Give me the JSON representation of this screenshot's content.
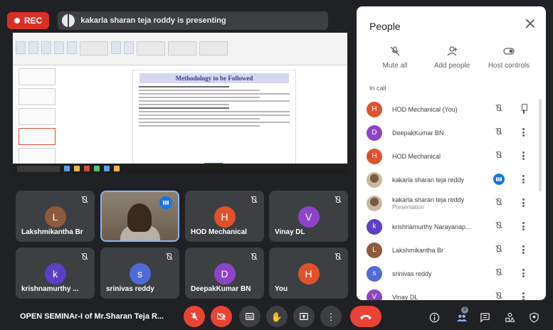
{
  "recording": {
    "label": "REC"
  },
  "presenting": {
    "text": "kakarla sharan teja roddy is presenting"
  },
  "slide": {
    "title": "Methodology to be Followed"
  },
  "tiles": [
    {
      "name": "Lakshmikantha Br",
      "initial": "L",
      "color": "#8d5a3b"
    },
    {
      "name": "",
      "initial": "",
      "color": ""
    },
    {
      "name": "HOD Mechanical",
      "initial": "H",
      "color": "#e0522b"
    },
    {
      "name": "Vinay DL",
      "initial": "V",
      "color": "#8e44c8"
    },
    {
      "name": "krishnamurthy ...",
      "initial": "k",
      "color": "#5b3fc8"
    },
    {
      "name": "srinivas reddy",
      "initial": "s",
      "color": "#4f6bd8"
    },
    {
      "name": "DeepakKumar BN",
      "initial": "D",
      "color": "#8e44c8"
    },
    {
      "name": "You",
      "initial": "H",
      "color": "#e0522b"
    }
  ],
  "people": {
    "title": "People",
    "actions": [
      {
        "label": "Mute all",
        "icon": "mute-all-icon"
      },
      {
        "label": "Add people",
        "icon": "add-people-icon"
      },
      {
        "label": "Host controls",
        "icon": "host-controls-icon"
      }
    ],
    "section": "In call",
    "list": [
      {
        "name": "HOD Mechanical (You)",
        "sub": "",
        "initial": "H",
        "color": "#e0522b"
      },
      {
        "name": "DeepakKumar BN",
        "sub": "",
        "initial": "D",
        "color": "#8e44c8"
      },
      {
        "name": "HOD Mechanical",
        "sub": "",
        "initial": "H",
        "color": "#e0522b"
      },
      {
        "name": "kakarla sharan teja reddy",
        "sub": "",
        "initial": "",
        "color": ""
      },
      {
        "name": "kakarla sharan teja reddy",
        "sub": "Presentation",
        "initial": "",
        "color": ""
      },
      {
        "name": "krishnamurthy Narayanap...",
        "sub": "",
        "initial": "k",
        "color": "#5b3fc8"
      },
      {
        "name": "Lakshmikantha Br",
        "sub": "",
        "initial": "L",
        "color": "#8d5a3b"
      },
      {
        "name": "srinivas reddy",
        "sub": "",
        "initial": "s",
        "color": "#4f6bd8"
      },
      {
        "name": "Vinay DL",
        "sub": "",
        "initial": "V",
        "color": "#8e44c8"
      }
    ]
  },
  "bottom": {
    "meeting_title": "OPEN SEMINAr-I of Mr.Sharan Teja R...",
    "participants_count": "9"
  }
}
